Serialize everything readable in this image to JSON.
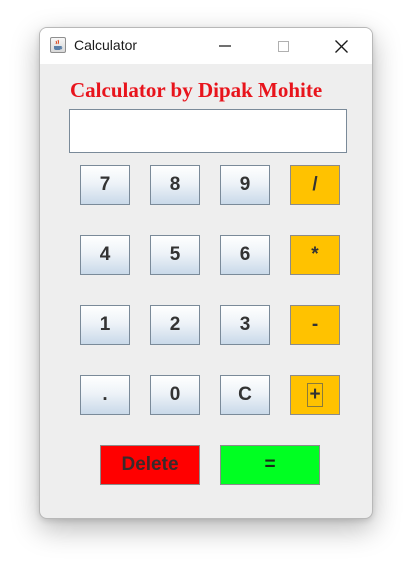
{
  "window": {
    "title": "Calculator"
  },
  "heading": "Calculator by Dipak Mohite",
  "display": {
    "value": ""
  },
  "keypad": {
    "rows": [
      [
        "7",
        "8",
        "9",
        "/"
      ],
      [
        "4",
        "5",
        "6",
        "*"
      ],
      [
        "1",
        "2",
        "3",
        "-"
      ],
      [
        ".",
        "0",
        "C",
        "+"
      ]
    ]
  },
  "actions": {
    "delete_label": "Delete",
    "equals_label": "="
  },
  "colors": {
    "heading": "#e8141c",
    "operator": "#ffc200",
    "delete": "#ff0000",
    "equals": "#00ff22",
    "digit_gradient_top": "#ffffff",
    "digit_gradient_bottom": "#c9d9e9"
  },
  "icons": {
    "app": "java-cup-icon",
    "minimize": "minimize-icon",
    "maximize": "maximize-icon",
    "close": "close-icon"
  }
}
